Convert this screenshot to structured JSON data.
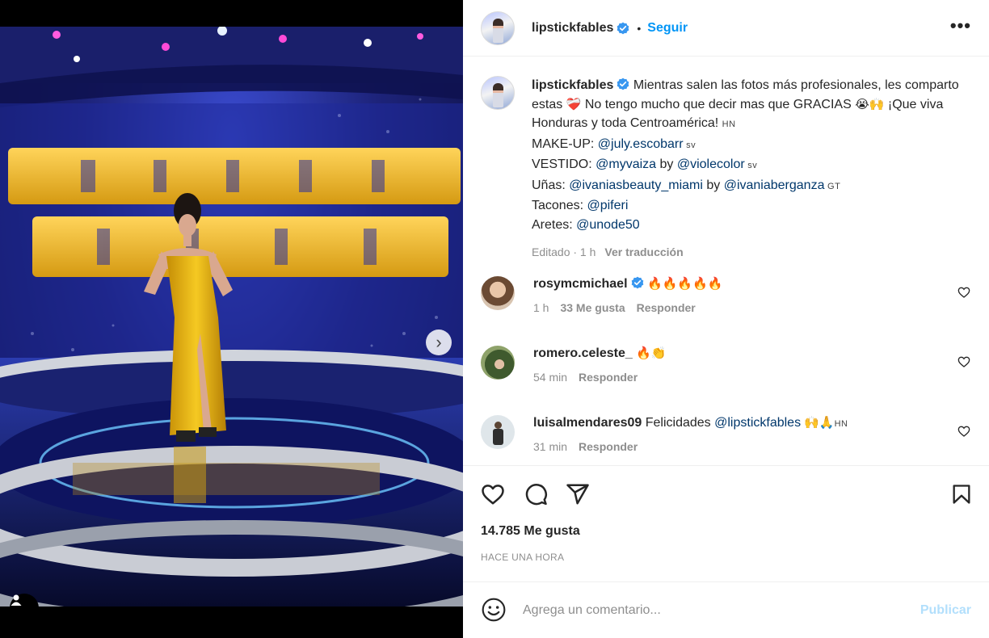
{
  "post": {
    "username": "lipstickfables",
    "separator": "•",
    "follow_label": "Seguir",
    "more_label": "•••"
  },
  "caption": {
    "username": "lipstickfables",
    "line1": " Mientras salen las fotos más profesionales, les comparto estas ",
    "emoji_heart": "❤️‍🩹",
    "line1b": " No tengo mucho que decir mas que GRACIAS ",
    "emoji_cry": "😭",
    "emoji_hands": "🙌",
    "line1c": " ¡Que viva Honduras y toda Centroamérica! ",
    "flag_hn": "HN",
    "makeup_label": "MAKE-UP: ",
    "makeup_mention": "@july.escobarr",
    "flag_sv": " sv",
    "vestido_label": "VESTIDO: ",
    "vestido_mention": "@myvaiza",
    "by_label": " by ",
    "vestido_mention2": "@violecolor",
    "flag_sv2": " sv",
    "unas_label": "Uñas: ",
    "unas_mention": "@ivaniasbeauty_miami",
    "by_label2": " by ",
    "unas_mention2": "@ivaniaberganza",
    "flag_gt": " GT",
    "tacones_label": "Tacones: ",
    "tacones_mention": "@piferi",
    "aretes_label": "Aretes: ",
    "aretes_mention": "@unode50",
    "edited": "Editado · 1 h",
    "translate": "Ver traducción"
  },
  "comments": [
    {
      "username": "rosymcmichael",
      "text": "🔥🔥🔥🔥🔥",
      "time": "1 h",
      "likes": "33 Me gusta",
      "reply": "Responder"
    },
    {
      "username": "romero.celeste_",
      "text": "🔥👏",
      "time": "54 min",
      "reply": "Responder"
    },
    {
      "username": "luisalmendares09",
      "text": " Felicidades ",
      "mention": "@lipstickfables",
      "emojis": " 🙌🙏",
      "flag": "HN",
      "time": "31 min",
      "reply": "Responder"
    }
  ],
  "stats": {
    "likes": "14.785 Me gusta",
    "time_ago": "HACE UNA HORA"
  },
  "add_comment": {
    "placeholder": "Agrega un comentario...",
    "publish": "Publicar"
  },
  "photo": {
    "carousel_position": 1,
    "carousel_total": 3
  },
  "colors": {
    "accent": "#0095f6",
    "verified": "#3897f0",
    "mention": "#00376b",
    "muted": "#8e8e8e",
    "publish_disabled": "#b2dffc",
    "gown": "#e7b80f"
  }
}
